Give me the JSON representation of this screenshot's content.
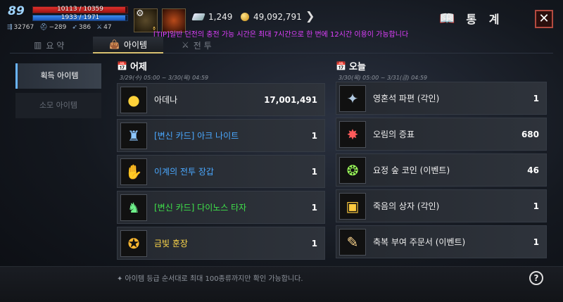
{
  "hud": {
    "level": "89",
    "hp_text": "10113 / 10359",
    "hp_fraction": 0.976,
    "mp_text": "1933 / 1971",
    "mp_fraction": 0.981,
    "stats": [
      {
        "icon": "speed-icon",
        "value": "32767"
      },
      {
        "icon": "helmet-icon",
        "value": "−289"
      },
      {
        "icon": "wing-icon",
        "value": "386"
      },
      {
        "icon": "sword-icon",
        "value": "47"
      }
    ],
    "currency_gem": "1,249",
    "currency_adena": "49,092,791",
    "tip": "[TIP]일반 던전의 충전 가능 시간은 최대 7시간으로 한 번에 12시간 이용이 가능합니다"
  },
  "panel": {
    "title": "통 계"
  },
  "tabs": [
    {
      "label": "요 약",
      "icon": "chart-icon"
    },
    {
      "label": "아이템",
      "icon": "bag-icon"
    },
    {
      "label": "전 투",
      "icon": "swords-icon"
    }
  ],
  "sidebar": {
    "items": [
      {
        "label": "획득 아이템",
        "active": true
      },
      {
        "label": "소모 아이템",
        "active": false
      }
    ]
  },
  "yesterday": {
    "title": "어제",
    "date": "3/29(수) 05:00 ~ 3/30(목) 04:59",
    "items": [
      {
        "name": "아데나",
        "qty": "17,001,491",
        "color": "white",
        "icon": "adena-coins-icon"
      },
      {
        "name": "[변신 카드] 아크 나이트",
        "qty": "1",
        "color": "blue",
        "icon": "polymorph-card-icon"
      },
      {
        "name": "이계의 전투 장갑",
        "qty": "1",
        "color": "blue",
        "icon": "gauntlet-icon"
      },
      {
        "name": "[변신 카드] 다이노스 타자",
        "qty": "1",
        "color": "green",
        "icon": "polymorph-card-icon"
      },
      {
        "name": "금빛 훈장",
        "qty": "1",
        "color": "yellow",
        "icon": "medal-icon"
      }
    ]
  },
  "today": {
    "title": "오늘",
    "date": "3/30(목) 05:00 ~ 3/31(금) 04:59",
    "items": [
      {
        "name": "영혼석 파편 (각인)",
        "qty": "1",
        "icon": "soulstone-shard-icon"
      },
      {
        "name": "오림의 증표",
        "qty": "680",
        "icon": "orim-emblem-icon"
      },
      {
        "name": "요정 숲 코인 (이벤트)",
        "qty": "46",
        "icon": "fairy-coin-icon"
      },
      {
        "name": "죽음의 상자 (각인)",
        "qty": "1",
        "icon": "treasure-chest-icon"
      },
      {
        "name": "축복 부여 주문서 (이벤트)",
        "qty": "1",
        "icon": "scroll-icon"
      }
    ]
  },
  "footer": {
    "note": "✦ 아이템 등급 순서대로 최대 100종류까지만 확인 가능합니다."
  }
}
